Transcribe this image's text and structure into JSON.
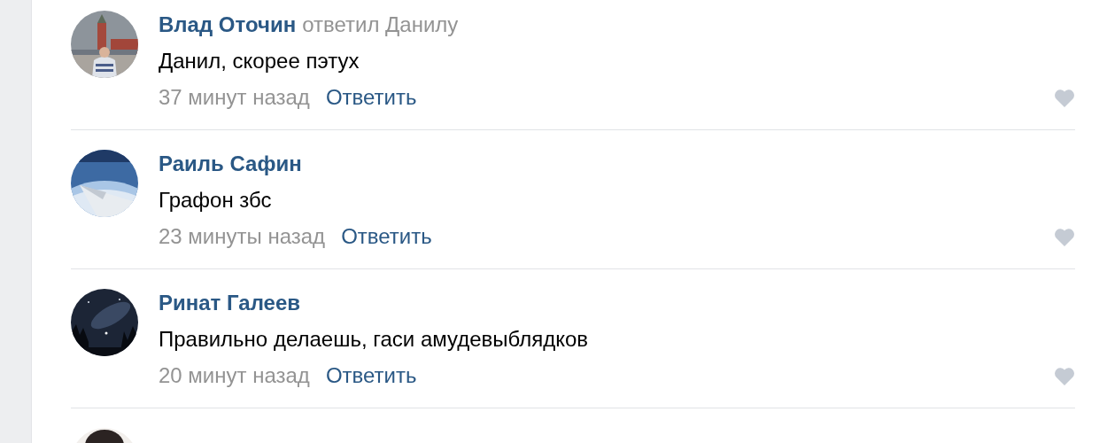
{
  "comments": [
    {
      "author": "Влад Оточин",
      "reply_to": "ответил Данилу",
      "text": "Данил, скорее пэтух",
      "time": "37 минут назад",
      "reply": "Ответить",
      "liked": false
    },
    {
      "author": "Раиль Сафин",
      "text": "Графон збс",
      "time": "23 минуты назад",
      "reply": "Ответить",
      "liked": false
    },
    {
      "author": "Ринат Галеев",
      "text": "Правильно делаешь, гаси амудевыблядков",
      "time": "20 минут назад",
      "reply": "Ответить",
      "liked": false
    }
  ]
}
